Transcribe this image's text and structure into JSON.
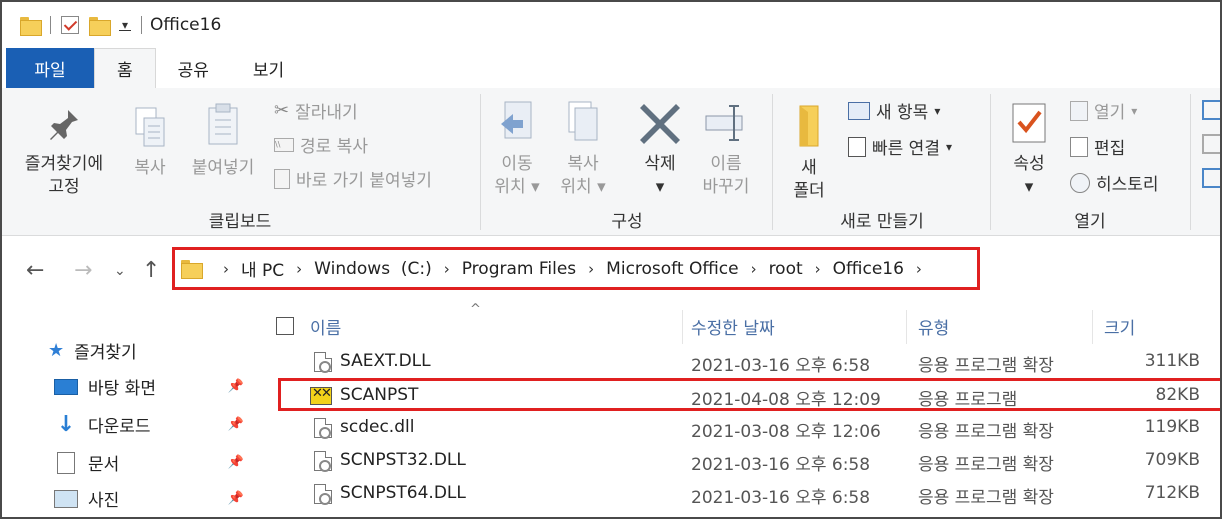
{
  "window": {
    "title": "Office16"
  },
  "ribbon_tabs": [
    {
      "label": "파일"
    },
    {
      "label": "홈"
    },
    {
      "label": "공유"
    },
    {
      "label": "보기"
    }
  ],
  "ribbon": {
    "clipboard": {
      "pin_line1": "즐겨찾기에",
      "pin_line2": "고정",
      "copy": "복사",
      "paste": "붙여넣기",
      "cut": "잘라내기",
      "copy_path": "경로 복사",
      "paste_shortcut": "바로 가기 붙여넣기",
      "label": "클립보드"
    },
    "organize": {
      "move_line1": "이동",
      "move_line2": "위치",
      "copy_line1": "복사",
      "copy_line2": "위치",
      "delete": "삭제",
      "rename_line1": "이름",
      "rename_line2": "바꾸기",
      "label": "구성"
    },
    "new": {
      "folder_line1": "새",
      "folder_line2": "폴더",
      "new_item": "새 항목",
      "easy_access": "빠른 연결",
      "label": "새로 만들기"
    },
    "open": {
      "properties": "속성",
      "open": "열기",
      "edit": "편집",
      "history": "히스토리",
      "label": "열기"
    }
  },
  "address_bar": {
    "crumbs": [
      "내 PC",
      "Windows  (C:)",
      "Program Files",
      "Microsoft Office",
      "root",
      "Office16"
    ]
  },
  "nav_pane": {
    "items": [
      {
        "label": "즐겨찾기"
      },
      {
        "label": "바탕 화면"
      },
      {
        "label": "다운로드"
      },
      {
        "label": "문서"
      },
      {
        "label": "사진"
      }
    ]
  },
  "file_list": {
    "columns": {
      "name": "이름",
      "date": "수정한 날짜",
      "type": "유형",
      "size": "크기"
    },
    "rows": [
      {
        "name": "SAEXT.DLL",
        "date": "2021-03-16 오후 6:58",
        "type": "응용 프로그램 확장",
        "size": "311KB",
        "icon": "dll-icon"
      },
      {
        "name": "SCANPST",
        "date": "2021-04-08 오후 12:09",
        "type": "응용 프로그램",
        "size": "82KB",
        "icon": "exe-icon"
      },
      {
        "name": "scdec.dll",
        "date": "2021-03-08 오후 12:06",
        "type": "응용 프로그램 확장",
        "size": "119KB",
        "icon": "dll-icon"
      },
      {
        "name": "SCNPST32.DLL",
        "date": "2021-03-16 오후 6:58",
        "type": "응용 프로그램 확장",
        "size": "709KB",
        "icon": "dll-icon"
      },
      {
        "name": "SCNPST64.DLL",
        "date": "2021-03-16 오후 6:58",
        "type": "응용 프로그램 확장",
        "size": "712KB",
        "icon": "dll-icon"
      }
    ]
  },
  "colors": {
    "file_tab": "#1a5fb4",
    "highlight_box": "#e02020",
    "header_text": "#4a6fa5"
  }
}
